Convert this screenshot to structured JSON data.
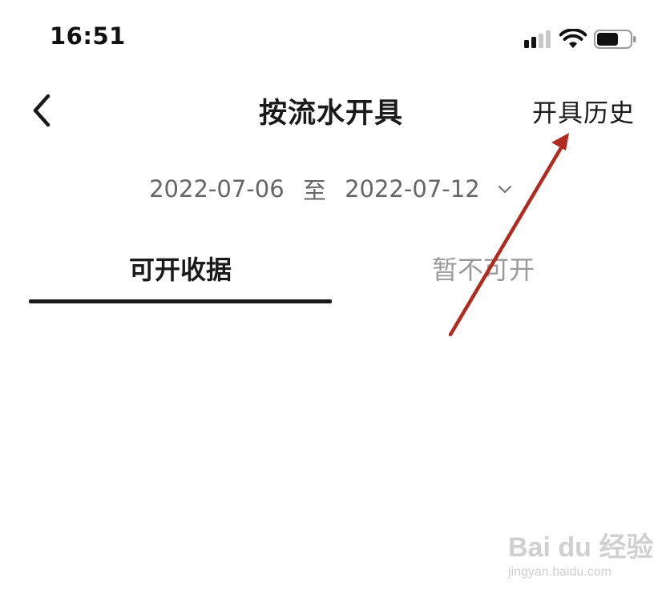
{
  "status_bar": {
    "time": "16:51",
    "signal_icon": "cellular-signal-icon",
    "wifi_icon": "wifi-icon",
    "battery_icon": "battery-icon",
    "battery_level": 0.65
  },
  "nav": {
    "back_icon": "chevron-left-icon",
    "title": "按流水开具",
    "history_label": "开具历史"
  },
  "date_range": {
    "start": "2022-07-06",
    "separator": "至",
    "end": "2022-07-12",
    "dropdown_icon": "chevron-down-icon"
  },
  "tabs": [
    {
      "label": "可开收据",
      "active": true
    },
    {
      "label": "暂不可开",
      "active": false
    }
  ],
  "annotation": {
    "color": "#b02a20"
  },
  "watermark": {
    "logo": "Bai du 经验",
    "url": "jingyan.baidu.com"
  }
}
